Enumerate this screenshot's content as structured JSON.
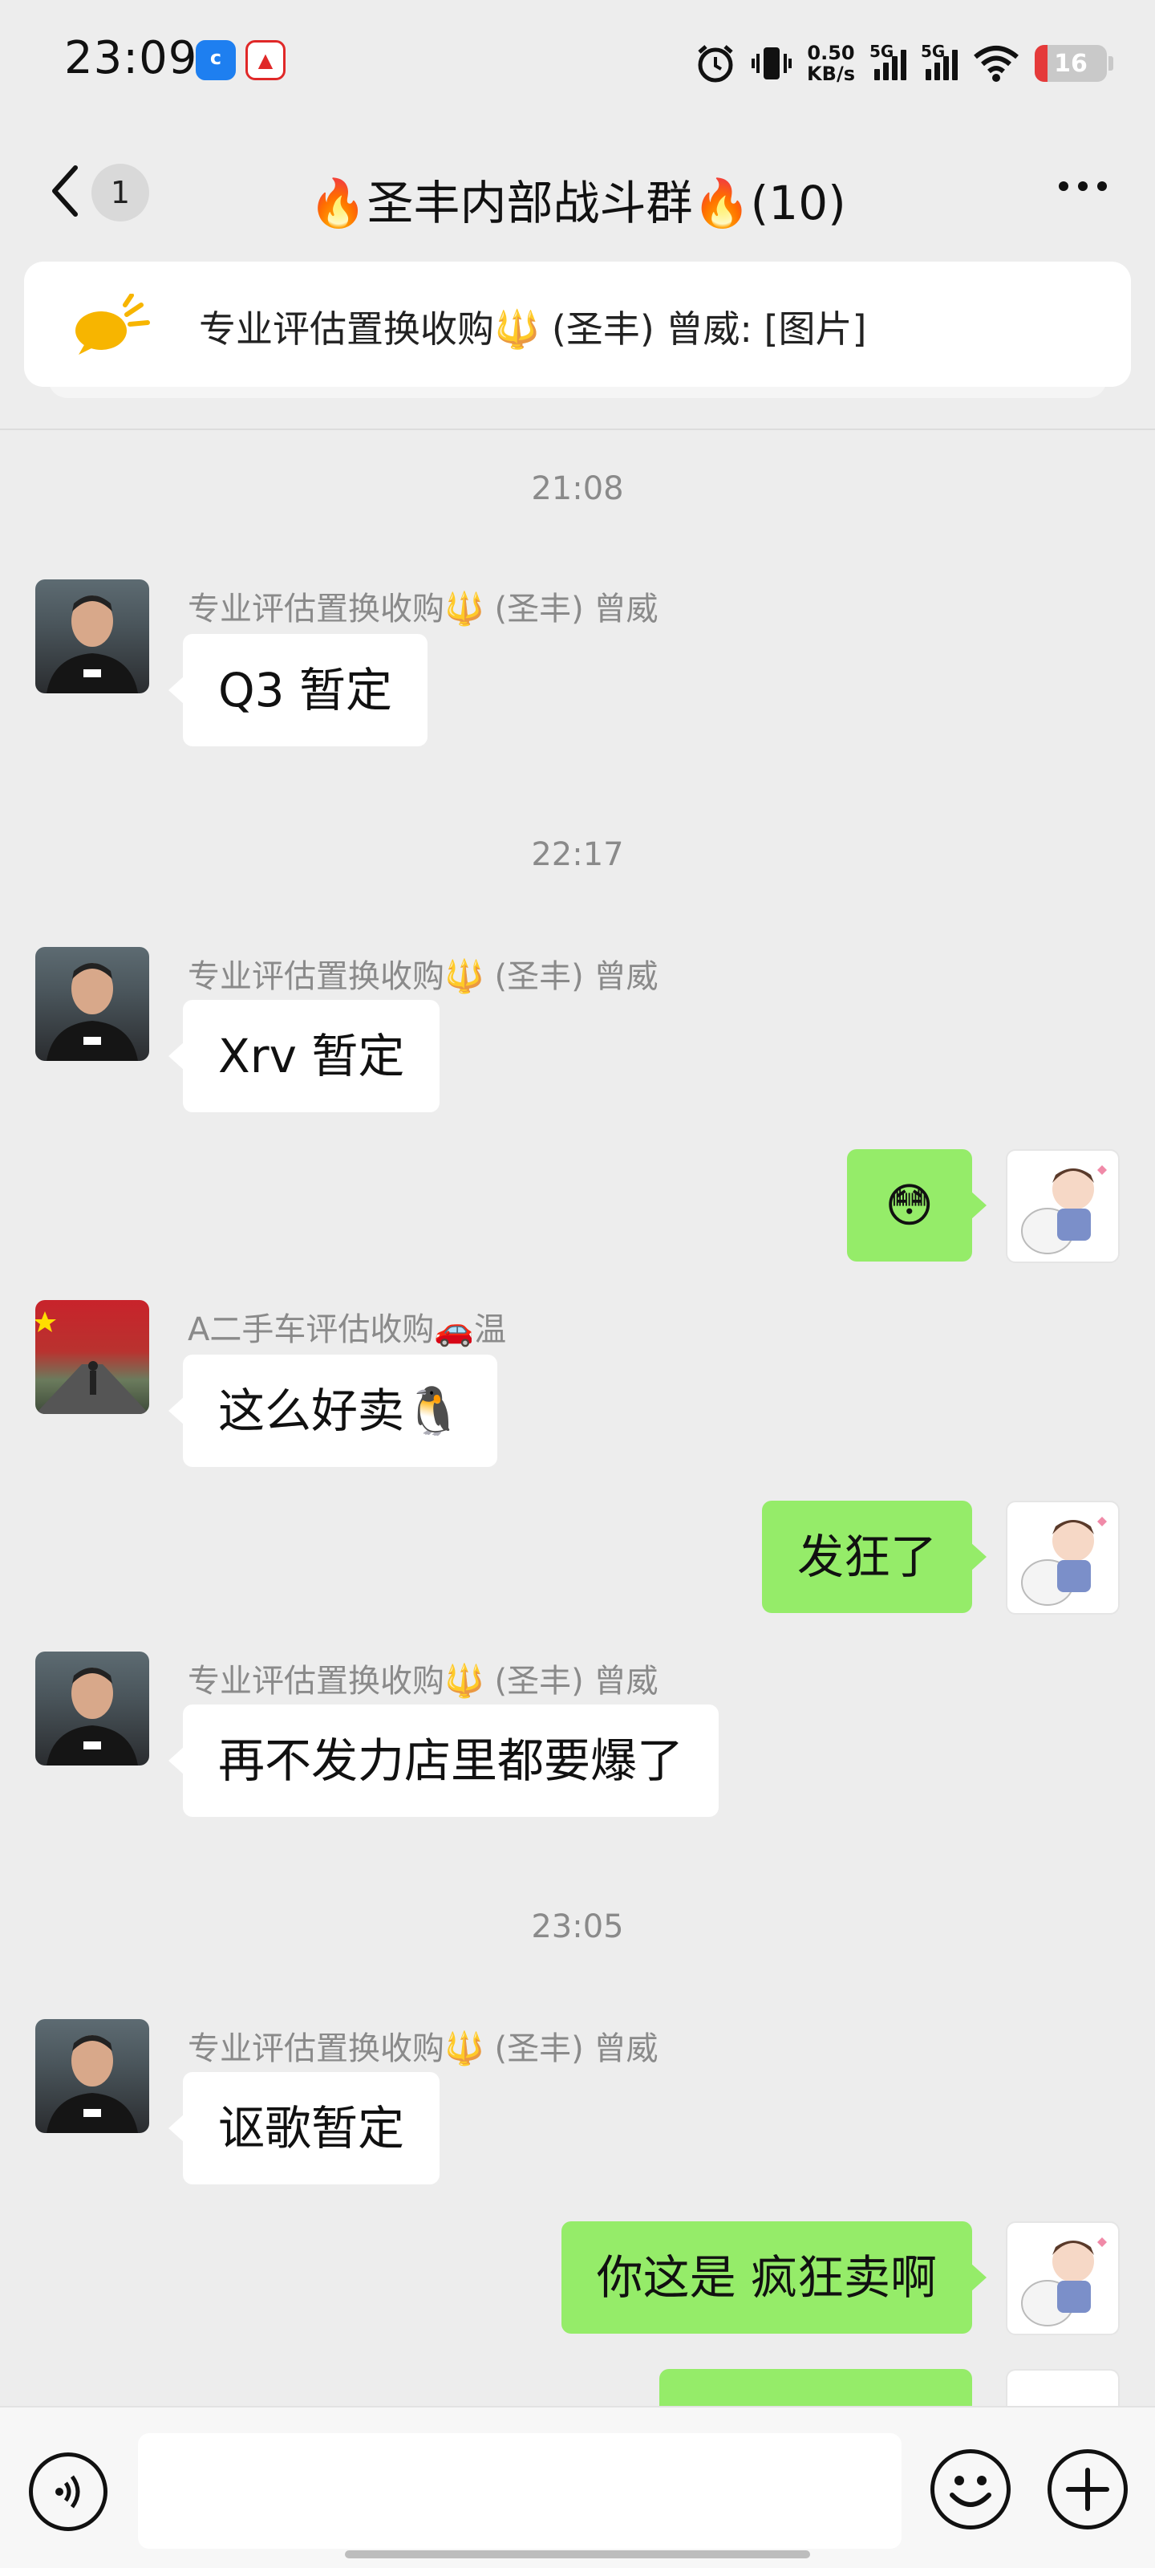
{
  "status_bar": {
    "time": "23:09",
    "net_speed_value": "0.50",
    "net_speed_unit": "KB/s",
    "signal1_label": "5G",
    "signal2_label": "5G",
    "battery": "16"
  },
  "header": {
    "unread_count": "1",
    "title": "🔥圣丰内部战斗群🔥(10)"
  },
  "pinned": {
    "text": "专业评估置换收购🔱 (圣丰) 曾威: [图片]"
  },
  "messages": [
    {
      "type": "timestamp",
      "text": "21:08"
    },
    {
      "type": "in",
      "sender": "专业评估置换收购🔱 (圣丰) 曾威",
      "text": "Q3 暂定"
    },
    {
      "type": "timestamp",
      "text": "22:17"
    },
    {
      "type": "in",
      "sender": "专业评估置换收购🔱 (圣丰) 曾威",
      "text": "Xrv 暂定"
    },
    {
      "type": "out",
      "text": "😳"
    },
    {
      "type": "in",
      "sender": "A二手车评估收购🚗温",
      "text": "这么好卖🐧"
    },
    {
      "type": "out",
      "text": "发狂了"
    },
    {
      "type": "in",
      "sender": "专业评估置换收购🔱 (圣丰) 曾威",
      "text": "再不发力店里都要爆了"
    },
    {
      "type": "timestamp",
      "text": "23:05"
    },
    {
      "type": "in",
      "sender": "专业评估置换收购🔱 (圣丰) 曾威",
      "text": "讴歌暂定"
    },
    {
      "type": "out",
      "text": "你这是 疯狂卖啊"
    }
  ],
  "input": {
    "value": "",
    "placeholder": ""
  },
  "colors": {
    "background": "#ededed",
    "outgoing_bubble": "#95ec69",
    "incoming_bubble": "#ffffff",
    "battery_low": "#e53a3a"
  },
  "icons": {
    "back": "chevron-left-icon",
    "more": "more-dots-icon",
    "pinned": "notice-bubble-icon",
    "voice": "voice-icon",
    "emoji": "emoji-icon",
    "plus": "plus-icon"
  }
}
